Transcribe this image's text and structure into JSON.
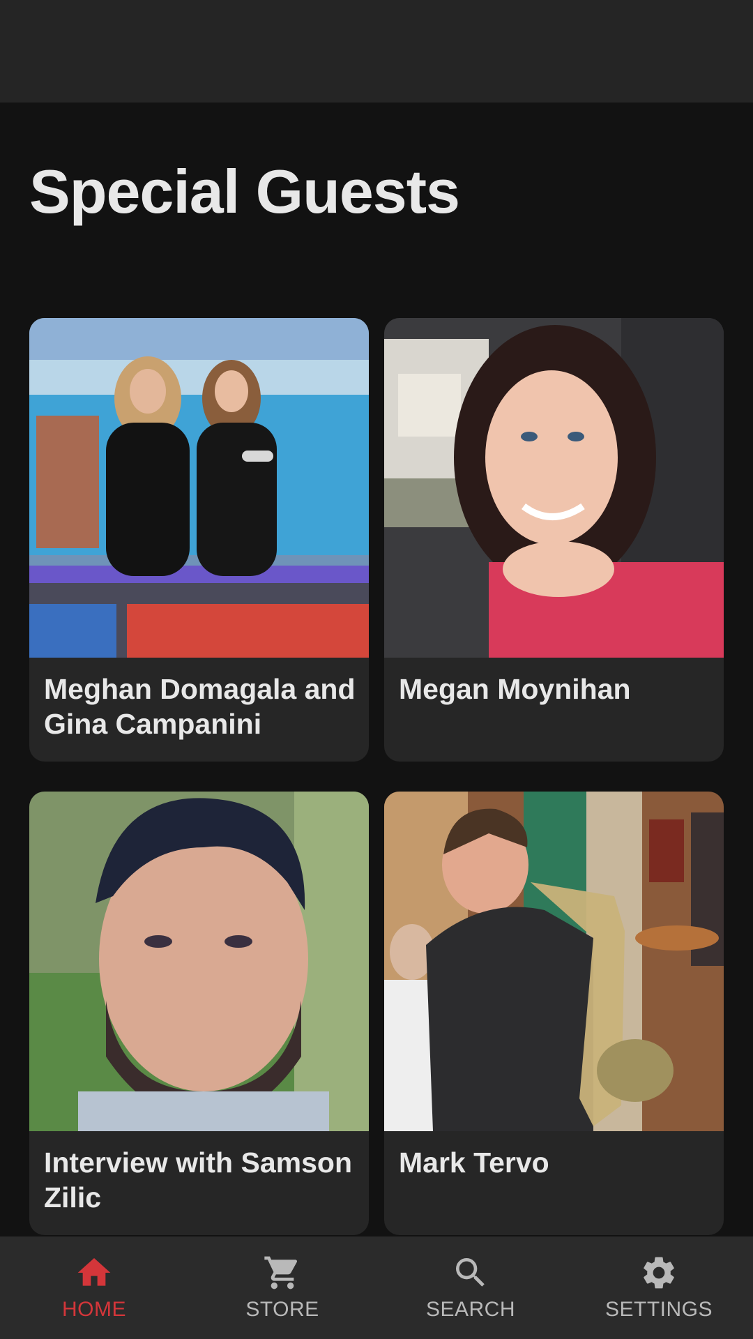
{
  "page": {
    "title": "Special Guests"
  },
  "guests": [
    {
      "name": "Meghan Domagala and Gina Campanini",
      "image": "two-women-game-show-photo"
    },
    {
      "name": "Megan Moynihan",
      "image": "woman-car-selfie-photo"
    },
    {
      "name": "Interview with Samson Zilic",
      "image": "man-portrait-photo"
    },
    {
      "name": "Mark Tervo",
      "image": "saxophone-player-photo"
    }
  ],
  "nav": {
    "items": [
      {
        "label": "HOME",
        "icon": "home-icon",
        "active": true
      },
      {
        "label": "STORE",
        "icon": "cart-icon",
        "active": false
      },
      {
        "label": "SEARCH",
        "icon": "search-icon",
        "active": false
      },
      {
        "label": "SETTINGS",
        "icon": "gear-icon",
        "active": false
      }
    ]
  },
  "colors": {
    "background": "#121212",
    "card": "#262626",
    "top_bar": "#252525",
    "nav_bar": "#2b2b2b",
    "accent": "#d4363a",
    "inactive": "#b9b9b9"
  }
}
